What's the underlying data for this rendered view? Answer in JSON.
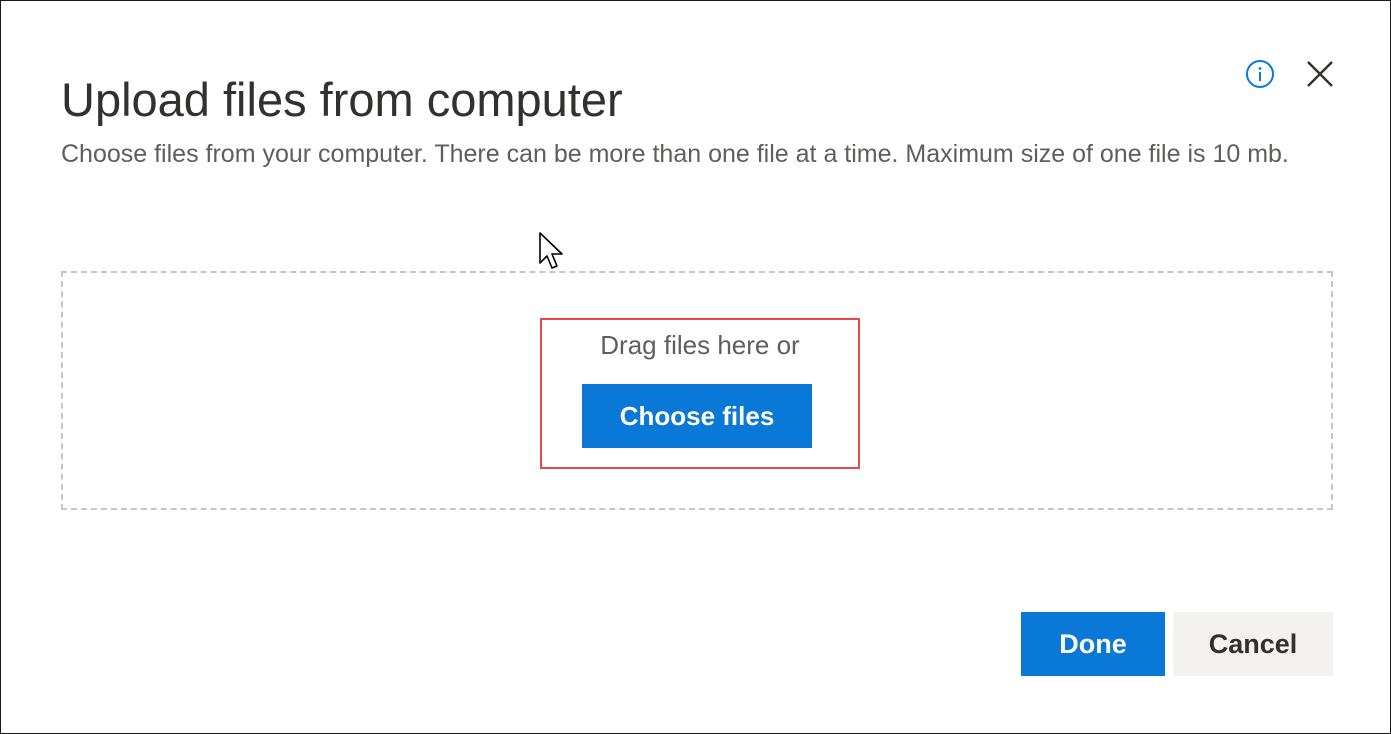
{
  "dialog": {
    "title": "Upload files from computer",
    "description": "Choose files from your computer. There can be more than one file at a time. Maximum size of one file is 10 mb.",
    "info_icon": "info-icon",
    "close_icon": "close-icon"
  },
  "dropzone": {
    "drag_text": "Drag files here or",
    "choose_label": "Choose files"
  },
  "footer": {
    "done_label": "Done",
    "cancel_label": "Cancel"
  },
  "colors": {
    "accent": "#0a78d7",
    "highlight": "#e8474c",
    "secondary_button": "#f3f2f1"
  }
}
